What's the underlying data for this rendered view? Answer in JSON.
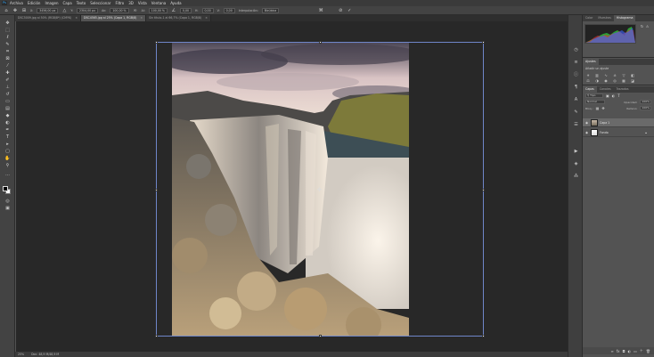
{
  "app": {
    "logo": "Ps"
  },
  "menu": [
    "Archivo",
    "Edición",
    "Imagen",
    "Capa",
    "Texto",
    "Seleccionar",
    "Filtro",
    "3D",
    "Vista",
    "Ventana",
    "Ayuda"
  ],
  "options_bar": {
    "width_value": "100,00 %",
    "height_value": "100,00 %",
    "angle_value": "0,00",
    "h_skew": "0,00",
    "v_skew": "0,00",
    "interpolation_label": "Interpolación:",
    "interpolation_value": "Bicúbica"
  },
  "document_tabs": [
    {
      "label": "DSC5009.jpg al 50% (RGB/8*) (CMYK)",
      "active": false
    },
    {
      "label": "DSC4565.jpg al 25% (Capa 1, RGB/8)",
      "active": true
    },
    {
      "label": "Sin título-1 al 66,7% (Capa 1, RGB/8)",
      "active": false
    }
  ],
  "status": {
    "zoom": "25%",
    "doc_info": "Doc: 48,9 M/48,9 M"
  },
  "panels": {
    "top_tabs": [
      "Color",
      "Muestras",
      "Histograma"
    ],
    "top_active": "Histograma",
    "adjust_tabs": [
      "Ajustes"
    ],
    "adjust_title": "Añadir un ajuste",
    "layer_tabs": [
      "Capas",
      "Canales",
      "Trazados"
    ],
    "blend_mode": "Normal",
    "opacity_label": "Opacidad:",
    "opacity_value": "100%",
    "fill_label": "Relleno:",
    "fill_value": "100%",
    "layers": [
      {
        "name": "Capa 1",
        "selected": true,
        "locked": false
      },
      {
        "name": "Fondo",
        "selected": false,
        "locked": true
      }
    ]
  },
  "colors": {
    "accent": "#31a8ff",
    "transform_box": "#6f86c9",
    "canvas_bg": "#282828"
  }
}
